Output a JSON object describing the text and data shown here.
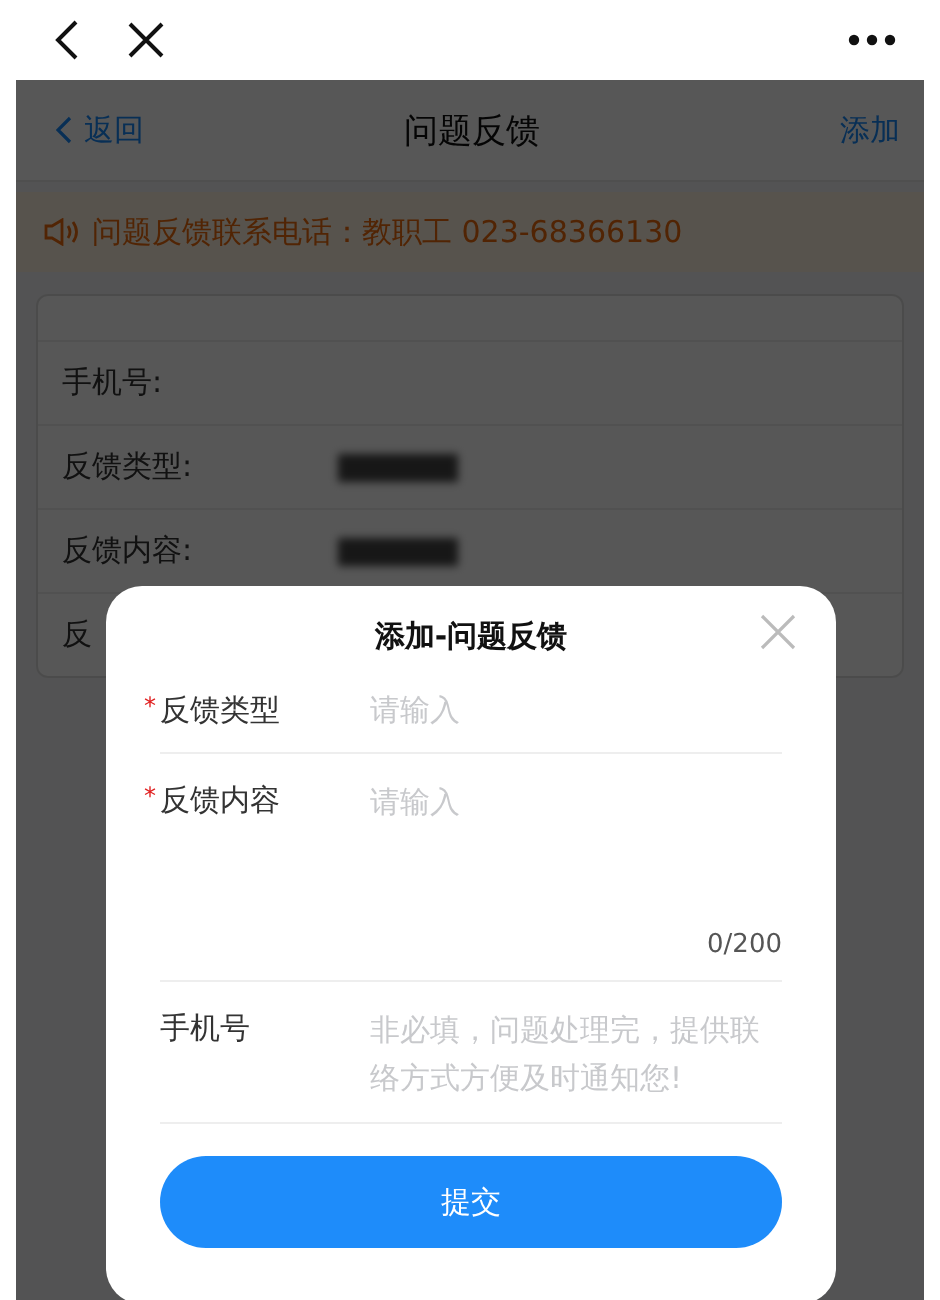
{
  "nav": {
    "back_label": "返回",
    "title": "问题反馈",
    "action": "添加"
  },
  "notice": {
    "text": "问题反馈联系电话：教职工 023-68366130"
  },
  "info_rows": [
    {
      "label": "手机号:",
      "redacted": false
    },
    {
      "label": "反馈类型:",
      "redacted": true
    },
    {
      "label": "反馈内容:",
      "redacted": true
    },
    {
      "label": "反",
      "redacted": false
    }
  ],
  "dialog": {
    "title": "添加-问题反馈",
    "required_mark": "*",
    "fields": [
      {
        "kind": "input",
        "label": "反馈类型",
        "required": true,
        "placeholder": "请输入"
      },
      {
        "kind": "textarea",
        "label": "反馈内容",
        "required": true,
        "placeholder": "请输入",
        "counter": "0/200"
      },
      {
        "kind": "textarea",
        "label": "手机号",
        "required": false,
        "placeholder": "非必填，问题处理完，提供联络方式方便及时通知您!"
      }
    ],
    "submit": "提交"
  }
}
